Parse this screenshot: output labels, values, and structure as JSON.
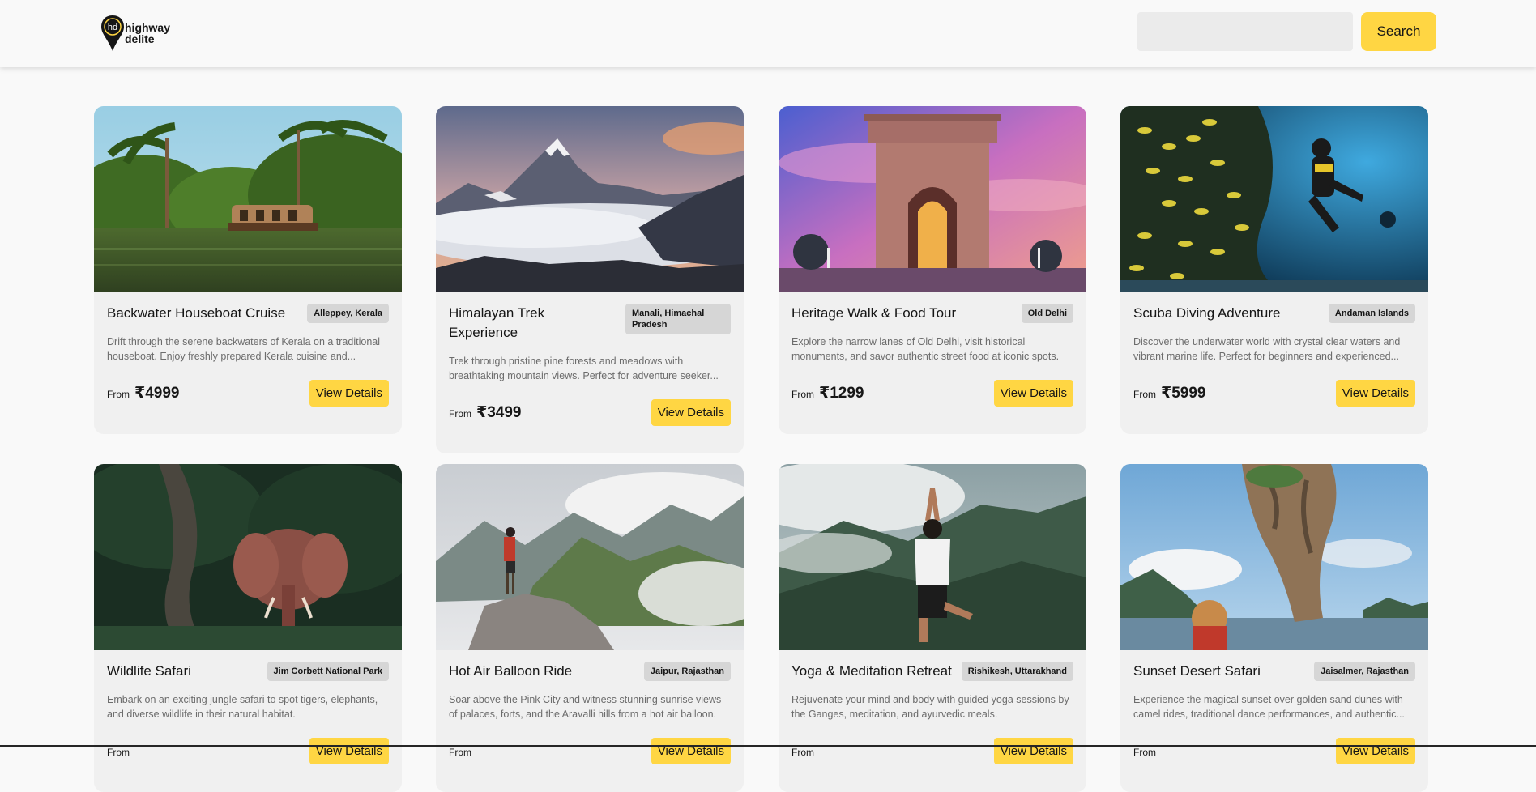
{
  "header": {
    "logo": {
      "line1": "highway",
      "line2": "delite",
      "mark": "hd"
    },
    "search": {
      "placeholder": "",
      "value": "",
      "button_label": "Search"
    }
  },
  "cards": [
    {
      "title": "Backwater Houseboat Cruise",
      "location": "Alleppey, Kerala",
      "description": "Drift through the serene backwaters of Kerala on a traditional houseboat. Enjoy freshly prepared Kerala cuisine and...",
      "from_label": "From",
      "price": "₹4999",
      "button_label": "View Details",
      "image": "kerala-backwaters-houseboat"
    },
    {
      "title": "Himalayan Trek Experience",
      "location": "Manali, Himachal Pradesh",
      "description": "Trek through pristine pine forests and meadows with breathtaking mountain views. Perfect for adventure seeker...",
      "from_label": "From",
      "price": "₹3499",
      "button_label": "View Details",
      "image": "himalaya-peaks-above-clouds"
    },
    {
      "title": "Heritage Walk & Food Tour",
      "location": "Old Delhi",
      "description": "Explore the narrow lanes of Old Delhi, visit historical monuments, and savor authentic street food at iconic spots.",
      "from_label": "From",
      "price": "₹1299",
      "button_label": "View Details",
      "image": "india-gate-sunset"
    },
    {
      "title": "Scuba Diving Adventure",
      "location": "Andaman Islands",
      "description": "Discover the underwater world with crystal clear waters and vibrant marine life. Perfect for beginners and experienced...",
      "from_label": "From",
      "price": "₹5999",
      "button_label": "View Details",
      "image": "scuba-diver-fish"
    },
    {
      "title": "Wildlife Safari",
      "location": "Jim Corbett National Park",
      "description": "Embark on an exciting jungle safari to spot tigers, elephants, and diverse wildlife in their natural habitat.",
      "from_label": "From",
      "price": "",
      "button_label": "View Details",
      "image": "elephant-in-forest"
    },
    {
      "title": "Hot Air Balloon Ride",
      "location": "Jaipur, Rajasthan",
      "description": "Soar above the Pink City and witness stunning sunrise views of palaces, forts, and the Aravalli hills from a hot air balloon.",
      "from_label": "From",
      "price": "",
      "button_label": "View Details",
      "image": "hiker-on-mountain-rock"
    },
    {
      "title": "Yoga & Meditation Retreat",
      "location": "Rishikesh, Uttarakhand",
      "description": "Rejuvenate your mind and body with guided yoga sessions by the Ganges, meditation, and ayurvedic meals.",
      "from_label": "From",
      "price": "",
      "button_label": "View Details",
      "image": "yoga-pose-mountains"
    },
    {
      "title": "Sunset Desert Safari",
      "location": "Jaisalmer, Rajasthan",
      "description": "Experience the magical sunset over golden sand dunes with camel rides, traditional dance performances, and authentic...",
      "from_label": "From",
      "price": "",
      "button_label": "View Details",
      "image": "sea-rock-pillar"
    }
  ],
  "colors": {
    "accent": "#ffd643",
    "background": "#f9f9f9",
    "card": "#f0f0f0",
    "badge": "#d6d6d6",
    "text": "#161616",
    "muted": "#6c6c6c"
  }
}
